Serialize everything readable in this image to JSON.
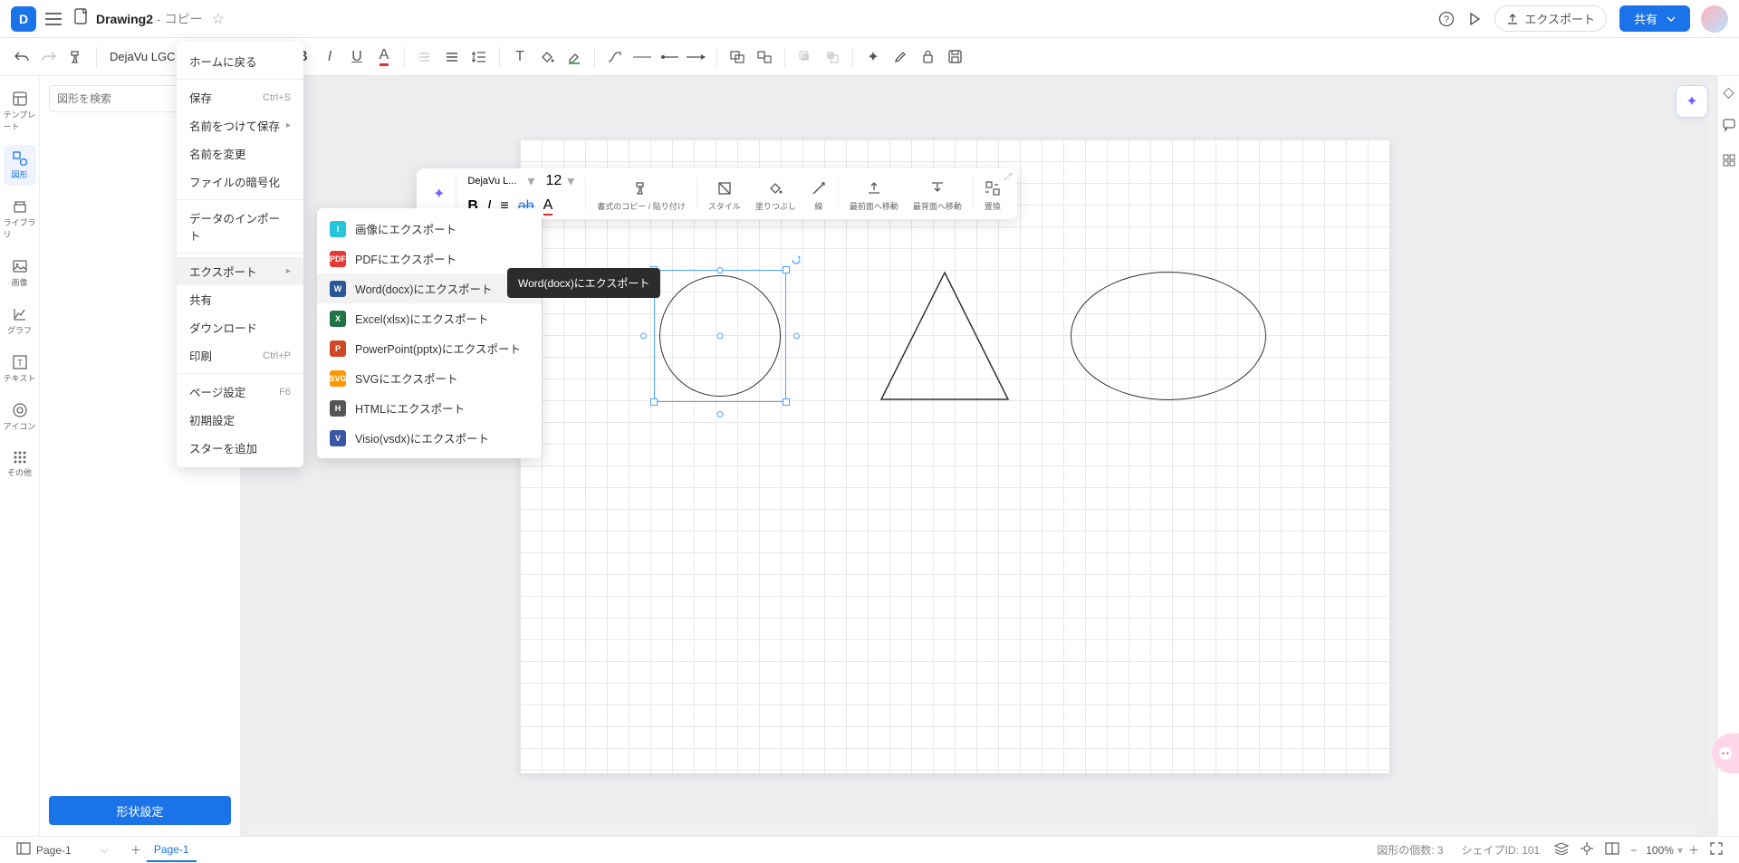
{
  "header": {
    "title": "Drawing2",
    "title_suffix": " - コピー",
    "export_label": "エクスポート",
    "share_label": "共有"
  },
  "toolbar": {
    "font_name": "DejaVu LGC Sa"
  },
  "rail": {
    "templates": "テンプレート",
    "shapes": "図形",
    "library": "ライブラリ",
    "images": "画像",
    "charts": "グラフ",
    "text": "テキスト",
    "icons": "アイコン",
    "more": "その他"
  },
  "left_panel": {
    "search_placeholder": "図形を検索",
    "shape_settings": "形状設定"
  },
  "file_menu": {
    "home": "ホームに戻る",
    "save": "保存",
    "save_sc": "Ctrl+S",
    "save_as": "名前をつけて保存",
    "rename": "名前を変更",
    "encrypt": "ファイルの暗号化",
    "import": "データのインポート",
    "export": "エクスポート",
    "share": "共有",
    "download": "ダウンロード",
    "print": "印刷",
    "print_sc": "Ctrl+P",
    "page_setup": "ページ設定",
    "page_sc": "F6",
    "init": "初期設定",
    "star": "スターを追加"
  },
  "export_menu": {
    "image": "画像にエクスポート",
    "pdf": "PDFにエクスポート",
    "word": "Word(docx)にエクスポート",
    "excel": "Excel(xlsx)にエクスポート",
    "ppt": "PowerPoint(pptx)にエクスポート",
    "svg": "SVGにエクスポート",
    "html": "HTMLにエクスポート",
    "visio": "Visio(vsdx)にエクスポート"
  },
  "tooltip": "Word(docx)にエクスポート",
  "ctx": {
    "font": "DejaVu L...",
    "size": "12",
    "copy_paste": "書式のコピー / 貼り付け",
    "style": "スタイル",
    "fill": "塗りつぶし",
    "line": "線",
    "front": "最前面へ移動",
    "back": "最背面へ移動",
    "replace": "置換"
  },
  "bottom": {
    "page_sel": "Page-1",
    "page_tab": "Page-1",
    "shape_count": "図形の個数: 3",
    "shape_id": "シェイプID: 101",
    "zoom": "100%"
  }
}
